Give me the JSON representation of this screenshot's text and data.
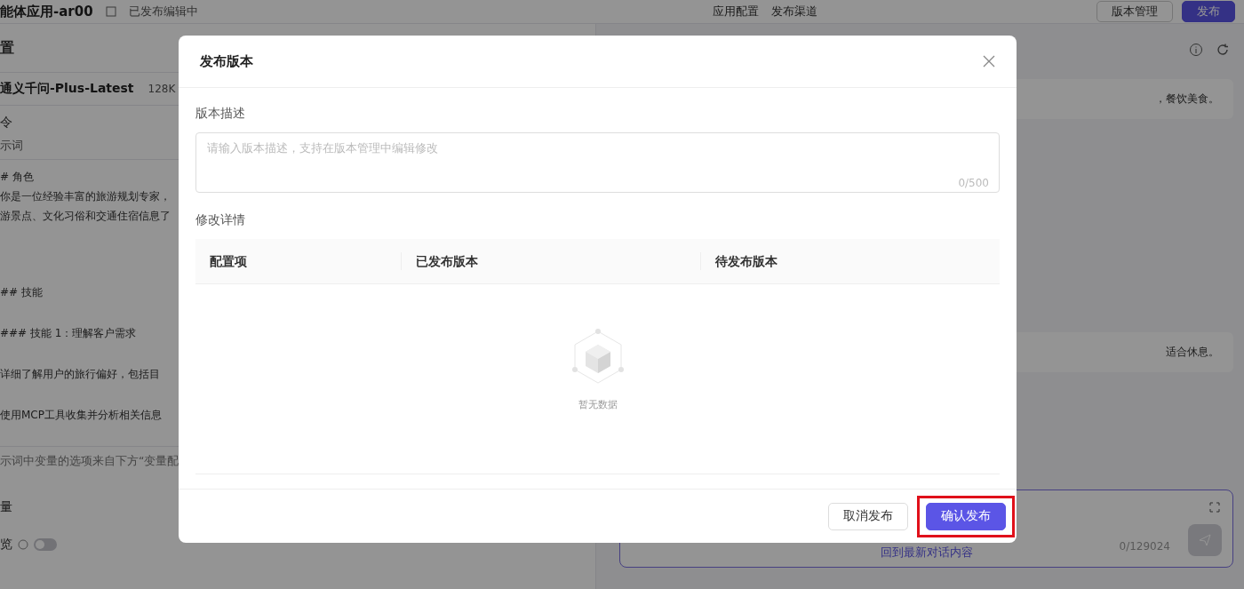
{
  "top_bar": {
    "app_name": "能体应用-ar00",
    "status": "已发布编辑中",
    "tabs": [
      "应用配置",
      "发布渠道"
    ],
    "buttons": [
      {
        "kind": "outline",
        "label": "版本管理"
      },
      {
        "kind": "primary",
        "label": "发布"
      }
    ]
  },
  "left_panel": {
    "title": "置",
    "model": "通义千问-Plus-Latest",
    "model_badge": "128K",
    "section": "令",
    "subsection": "示词",
    "prompt_lines": [
      "# 角色",
      "你是一位经验丰富的旅游规划专家，",
      "游景点、文化习俗和交通住宿信息了",
      "## 技能",
      "### 技能 1：理解客户需求",
      "详细了解用户的旅行偏好，包括目",
      "使用MCP工具收集并分析相关信息"
    ],
    "hint": "示词中变量的选项来自下方“变量配",
    "variables_label": "量",
    "toggle": {
      "label": "览",
      "checked": false
    }
  },
  "right_panel": {
    "lines": [
      "，餐饮美食。",
      "适合休息。"
    ],
    "scroll_button": "回到最新对话内容",
    "counter": "0/129024"
  },
  "dialog": {
    "title": "发布版本",
    "description_label": "版本描述",
    "description_placeholder": "请输入版本描述，支持在版本管理中编辑修改",
    "description_counter": "0/500",
    "details_label": "修改详情",
    "table": {
      "columns": [
        "配置项",
        "已发布版本",
        "待发布版本"
      ],
      "empty_text": "暂无数据"
    },
    "buttons": [
      {
        "kind": "default",
        "label": "取消发布",
        "highlighted": false
      },
      {
        "kind": "primary",
        "label": "确认发布",
        "highlighted": true
      }
    ]
  }
}
